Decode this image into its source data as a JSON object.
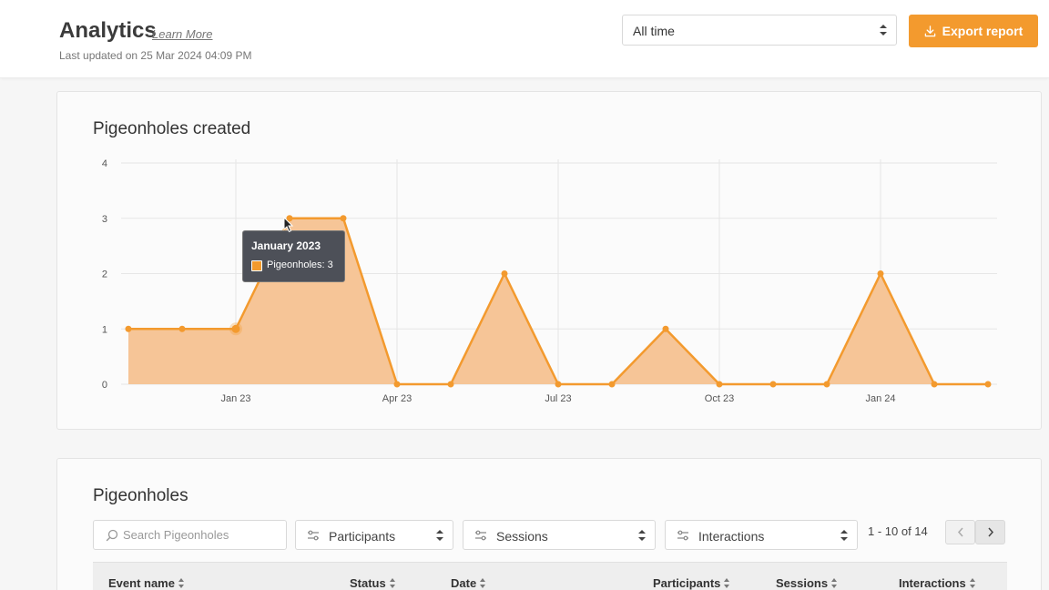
{
  "header": {
    "title": "Analytics",
    "learn_more": "Learn More",
    "last_updated": "Last updated on 25 Mar 2024 04:09 PM",
    "range_select": "All time",
    "export_label": "Export report"
  },
  "chart_card": {
    "title": "Pigeonholes created",
    "tooltip": {
      "title": "January 2023",
      "label": "Pigeonholes: 3"
    }
  },
  "chart_data": {
    "type": "area",
    "title": "Pigeonholes created",
    "xlabel": "",
    "ylabel": "",
    "ylim": [
      0,
      4
    ],
    "yticks": [
      0,
      1,
      2,
      3,
      4
    ],
    "xtick_labels": [
      "Jan 23",
      "Apr 23",
      "Jul 23",
      "Oct 23",
      "Jan 24"
    ],
    "x": [
      "2022-11",
      "2022-12",
      "2023-01",
      "2023-02",
      "2023-03",
      "2023-04",
      "2023-05",
      "2023-06",
      "2023-07",
      "2023-08",
      "2023-09",
      "2023-10",
      "2023-11",
      "2023-12",
      "2024-01",
      "2024-02",
      "2024-03"
    ],
    "series": [
      {
        "name": "Pigeonholes",
        "values": [
          1,
          1,
          1,
          3,
          3,
          0,
          0,
          2,
          0,
          0,
          1,
          0,
          0,
          0,
          2,
          0,
          0
        ]
      }
    ],
    "highlighted_point": "2023-01",
    "grid": true,
    "colors": {
      "line": "#f39a2e",
      "fill": "#f6c597"
    }
  },
  "table_card": {
    "title": "Pigeonholes",
    "search_placeholder": "Search Pigeonholes",
    "filters": [
      "Participants",
      "Sessions",
      "Interactions"
    ],
    "pager": "1 - 10 of 14",
    "columns": [
      "Event name",
      "Status",
      "Date",
      "Participants",
      "Sessions",
      "Interactions"
    ]
  },
  "colors": {
    "accent": "#f39a2e",
    "background": "#f6f6f6"
  },
  "icons": {
    "export": "download-icon",
    "search": "search-icon",
    "filter": "sliders-icon",
    "prev": "chevron-left-icon",
    "next": "chevron-right-icon"
  }
}
